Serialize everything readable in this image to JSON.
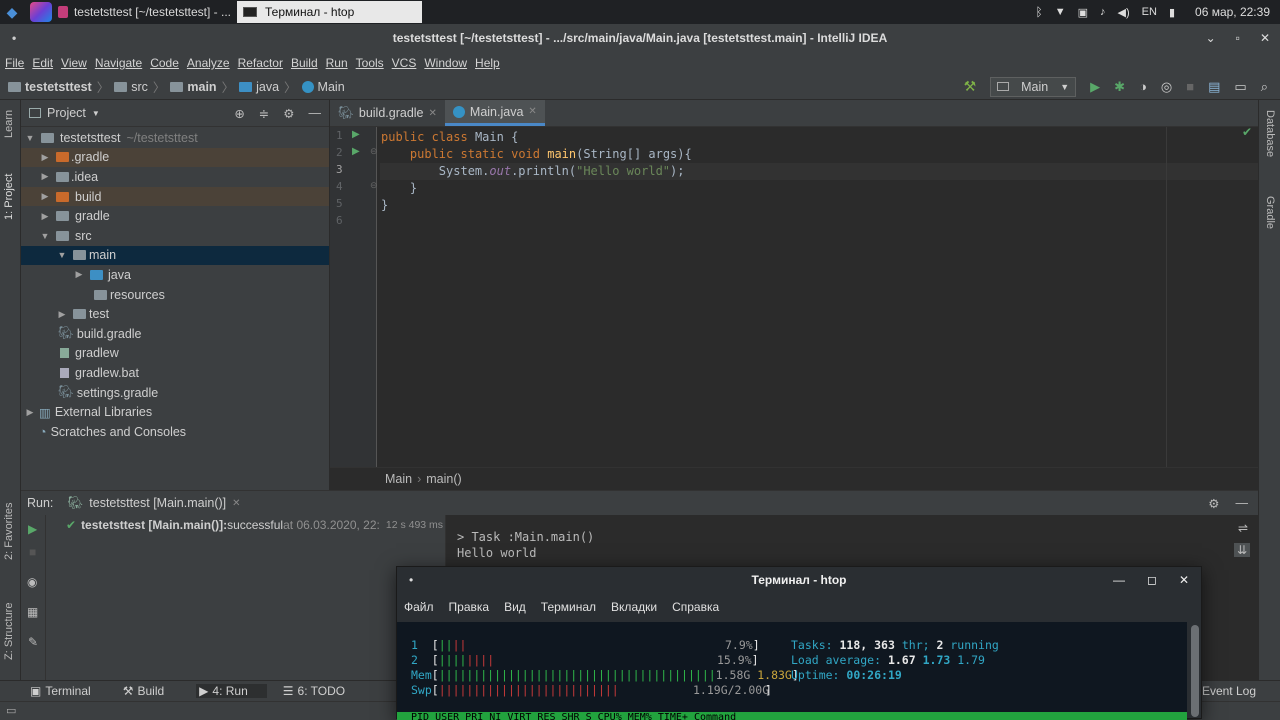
{
  "taskbar": {
    "tasks": [
      "testetsttest [~/testetsttest] - ...",
      "Терминал - htop"
    ],
    "lang": "EN",
    "clock": "06 мар, 22:39"
  },
  "window": {
    "title": "testetsttest [~/testetsttest] - .../src/main/java/Main.java [testetsttest.main] - IntelliJ IDEA"
  },
  "menu": [
    "File",
    "Edit",
    "View",
    "Navigate",
    "Code",
    "Analyze",
    "Refactor",
    "Build",
    "Run",
    "Tools",
    "VCS",
    "Window",
    "Help"
  ],
  "breadcrumb": [
    "testetsttest",
    "src",
    "main",
    "java",
    "Main"
  ],
  "run_config": "Main",
  "side_left": {
    "learn": "Learn",
    "project": "1: Project",
    "favorites": "2: Favorites",
    "structure": "Z: Structure"
  },
  "side_right": {
    "database": "Database",
    "gradle": "Gradle"
  },
  "project": {
    "title": "Project",
    "root": "testetsttest",
    "root_path": "~/testetsttest",
    "items": [
      {
        "label": ".gradle"
      },
      {
        "label": ".idea"
      },
      {
        "label": "build"
      },
      {
        "label": "gradle"
      },
      {
        "label": "src"
      },
      {
        "label": "main"
      },
      {
        "label": "java"
      },
      {
        "label": "resources"
      },
      {
        "label": "test"
      },
      {
        "label": "build.gradle"
      },
      {
        "label": "gradlew"
      },
      {
        "label": "gradlew.bat"
      },
      {
        "label": "settings.gradle"
      },
      {
        "label": "External Libraries"
      },
      {
        "label": "Scratches and Consoles"
      }
    ]
  },
  "editor": {
    "tabs": [
      "build.gradle",
      "Main.java"
    ],
    "lines": [
      "1",
      "2",
      "3",
      "4",
      "5",
      "6"
    ],
    "code": {
      "l1_kw1": "public",
      "l1_kw2": "class",
      "l1_name": "Main {",
      "l2_kw1": "public",
      "l2_kw2": "static",
      "l2_kw3": "void",
      "l2_fn": "main",
      "l2_rest": "(String[] args){",
      "l3_a": "System.",
      "l3_out": "out",
      "l3_b": ".println(",
      "l3_str": "\"Hello world\"",
      "l3_c": ");",
      "l4": "}",
      "l5": "}"
    },
    "crumb": [
      "Main",
      "main()"
    ]
  },
  "run": {
    "label": "Run:",
    "tab": "testetsttest [Main.main()]",
    "result_bold": "testetsttest [Main.main()]:",
    "result_text": " successful",
    "result_time": " at 06.03.2020, 22:",
    "duration": "12 s 493 ms",
    "console": [
      "> Task :Main.main()",
      "Hello world"
    ]
  },
  "bottom_tools": [
    "Terminal",
    "Build",
    "4: Run",
    "6: TODO"
  ],
  "event_log": "Event Log",
  "terminal": {
    "title": "Терминал - htop",
    "menu": [
      "Файл",
      "Правка",
      "Вид",
      "Терминал",
      "Вкладки",
      "Справка"
    ],
    "cpu1_label": "1",
    "cpu1_pct": "7.9%",
    "cpu2_label": "2",
    "cpu2_pct": "15.9%",
    "mem_label": "Mem",
    "mem_used": "1.58G",
    "mem_buf": "1.83G",
    "swp_label": "Swp",
    "swp_val": "1.19G/2.00G",
    "tasks_label": "Tasks:",
    "tasks": "118,",
    "thr": "363",
    "thr_label": "thr;",
    "running": "2",
    "running_label": "running",
    "load_label": "Load average:",
    "load1": "1.67",
    "load2": "1.73",
    "load3": "1.79",
    "uptime_label": "Uptime:",
    "uptime": "00:26:19",
    "header": "PID USER      PRI  NI  VIRT   RES   SHR S CPU% MEM%   TIME+  Command"
  }
}
